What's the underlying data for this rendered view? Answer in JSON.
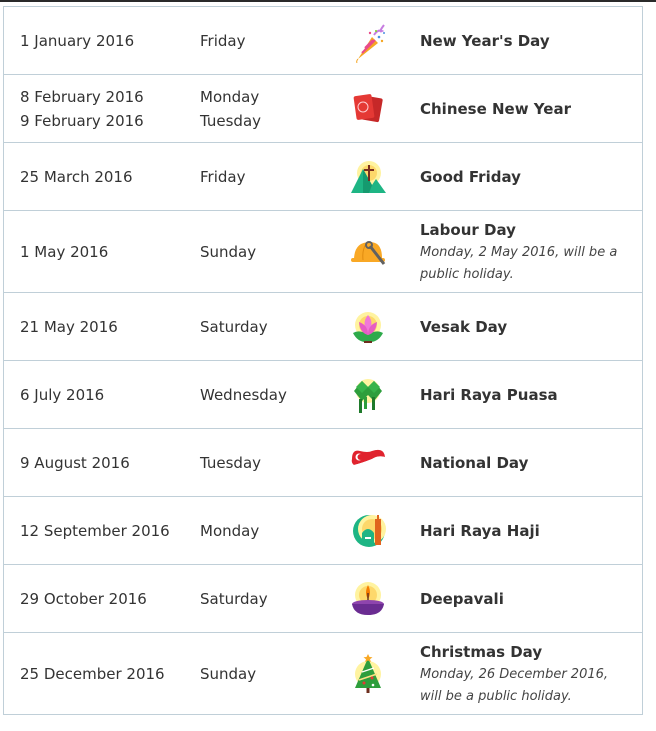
{
  "holidays": [
    {
      "dates": [
        "1 January 2016"
      ],
      "days": [
        "Friday"
      ],
      "icon": "party-popper-icon",
      "name": "New Year's Day",
      "note": ""
    },
    {
      "dates": [
        "8 February 2016",
        "9 February 2016"
      ],
      "days": [
        "Monday",
        "Tuesday"
      ],
      "icon": "red-packet-icon",
      "name": "Chinese New Year",
      "note": ""
    },
    {
      "dates": [
        "25 March 2016"
      ],
      "days": [
        "Friday"
      ],
      "icon": "cross-mountain-icon",
      "name": "Good Friday",
      "note": ""
    },
    {
      "dates": [
        "1 May 2016"
      ],
      "days": [
        "Sunday"
      ],
      "icon": "hard-hat-wrench-icon",
      "name": "Labour Day",
      "note": "Monday, 2 May 2016, will be a public holiday."
    },
    {
      "dates": [
        "21 May 2016"
      ],
      "days": [
        "Saturday"
      ],
      "icon": "lotus-icon",
      "name": "Vesak Day",
      "note": ""
    },
    {
      "dates": [
        "6 July 2016"
      ],
      "days": [
        "Wednesday"
      ],
      "icon": "ketupat-icon",
      "name": "Hari Raya Puasa",
      "note": ""
    },
    {
      "dates": [
        "9 August 2016"
      ],
      "days": [
        "Tuesday"
      ],
      "icon": "singapore-flag-heart-icon",
      "name": "National Day",
      "note": ""
    },
    {
      "dates": [
        "12 September 2016"
      ],
      "days": [
        "Monday"
      ],
      "icon": "mosque-crescent-icon",
      "name": "Hari Raya Haji",
      "note": ""
    },
    {
      "dates": [
        "29 October 2016"
      ],
      "days": [
        "Saturday"
      ],
      "icon": "diya-lamp-icon",
      "name": "Deepavali",
      "note": ""
    },
    {
      "dates": [
        "25 December 2016"
      ],
      "days": [
        "Sunday"
      ],
      "icon": "christmas-tree-icon",
      "name": "Christmas Day",
      "note": "Monday, 26 December 2016, will be a public holiday."
    }
  ],
  "colors": {
    "border": "#c0cfd8",
    "text": "#333333"
  }
}
